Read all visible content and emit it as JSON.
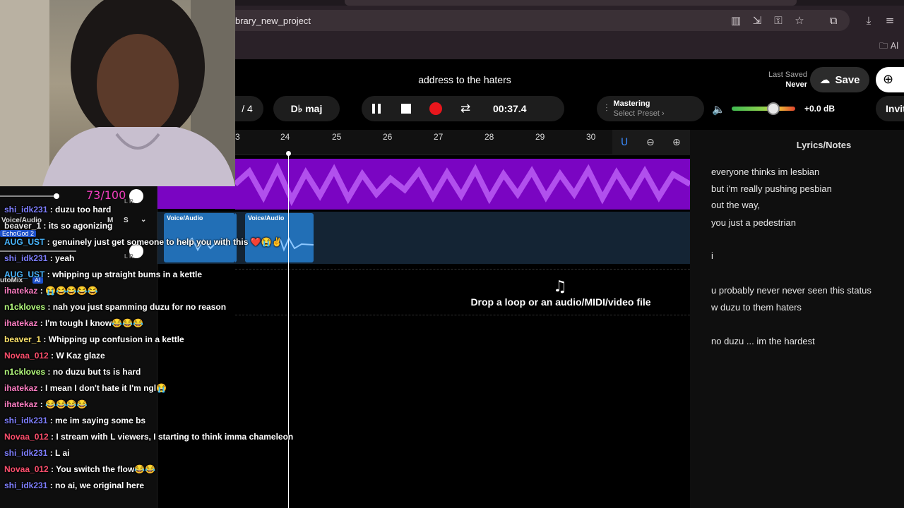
{
  "browser": {
    "url": "brary_new_project",
    "bookmarks_all": "Al"
  },
  "daw": {
    "project_title": "address to the haters",
    "last_saved_label": "Last Saved",
    "last_saved_value": "Never",
    "save_label": "Save",
    "invite_label": "Invit",
    "time_signature": "/ 4",
    "key": "D♭ maj",
    "time": "00:37.4",
    "mastering_label": "Mastering",
    "mastering_preset": "Select Preset ›",
    "volume_db": "+0.0 dB",
    "volume_level": 0.65,
    "ruler_ticks": [
      "3",
      "24",
      "25",
      "26",
      "27",
      "28",
      "29",
      "30"
    ],
    "clip_label_1": "Voice/Audio",
    "clip_label_2": "Voice/Audio",
    "drop_text": "Drop a loop or an audio/MIDI/video file",
    "colors": {
      "track_purple": "#7a05c2",
      "clip_blue": "#226fb6",
      "record_red": "#e8161c"
    }
  },
  "left_panel": {
    "score": "73/100",
    "track_label": "Voice/Audio",
    "echo_badge": "EchoGod 2",
    "mute_label": "M",
    "solo_label": "S",
    "automix_label": "utoMix",
    "ai_badge": "AI",
    "lr_1": "L  R",
    "lr_2": "L  R"
  },
  "lyrics": {
    "title": "Lyrics/Notes",
    "lines": [
      "everyone thinks im lesbian",
      "but i'm really pushing pesbian",
      "out the way,",
      "you just a pedestrian",
      "i",
      "u probably never never seen this status",
      "w duzu to them haters",
      "no duzu ... im the hardest"
    ]
  },
  "chat": [
    {
      "user": "shi_idk231",
      "color": "#7f7fff",
      "text": " : duzu too hard"
    },
    {
      "user": "beaver_1",
      "color": "#e8e8e8",
      "text": " : its so agonizing"
    },
    {
      "user": "AUG_UST",
      "color": "#49b7ff",
      "text": " : genuinely just get someone to help you with this ❤️😭✌️"
    },
    {
      "user": "shi_idk231",
      "color": "#7f7fff",
      "text": " : yeah"
    },
    {
      "user": "AUG_UST",
      "color": "#49b7ff",
      "text": " : whipping up straight bums in a kettle"
    },
    {
      "user": "ihatekaz",
      "color": "#ff7fc4",
      "text": " : 😭😂😂😂😂"
    },
    {
      "user": "n1ckloves",
      "color": "#b7ff7f",
      "text": " : nah you just spamming duzu for no reason"
    },
    {
      "user": "ihatekaz",
      "color": "#ff7fc4",
      "text": " : I'm tough I know😂😂😂"
    },
    {
      "user": "beaver_1",
      "color": "#ffe46b",
      "text": " : Whipping up confusion in a kettle"
    },
    {
      "user": "Novaa_012",
      "color": "#ff4f6d",
      "text": " : W Kaz glaze"
    },
    {
      "user": "n1ckloves",
      "color": "#b7ff7f",
      "text": " : no duzu but ts is hard"
    },
    {
      "user": "ihatekaz",
      "color": "#ff7fc4",
      "text": " : I mean I don't hate it I'm ngl😭"
    },
    {
      "user": "ihatekaz",
      "color": "#ff7fc4",
      "text": " : 😂😂😂😂"
    },
    {
      "user": "shi_idk231",
      "color": "#7f7fff",
      "text": " : me im saying some bs"
    },
    {
      "user": "Novaa_012",
      "color": "#ff4f6d",
      "text": " : I stream with L viewers, I starting to think imma chameleon"
    },
    {
      "user": "shi_idk231",
      "color": "#7f7fff",
      "text": " : L ai"
    },
    {
      "user": "Novaa_012",
      "color": "#ff4f6d",
      "text": " : You switch the flow😂😂"
    },
    {
      "user": "shi_idk231",
      "color": "#7f7fff",
      "text": " : no ai, we original here"
    }
  ]
}
